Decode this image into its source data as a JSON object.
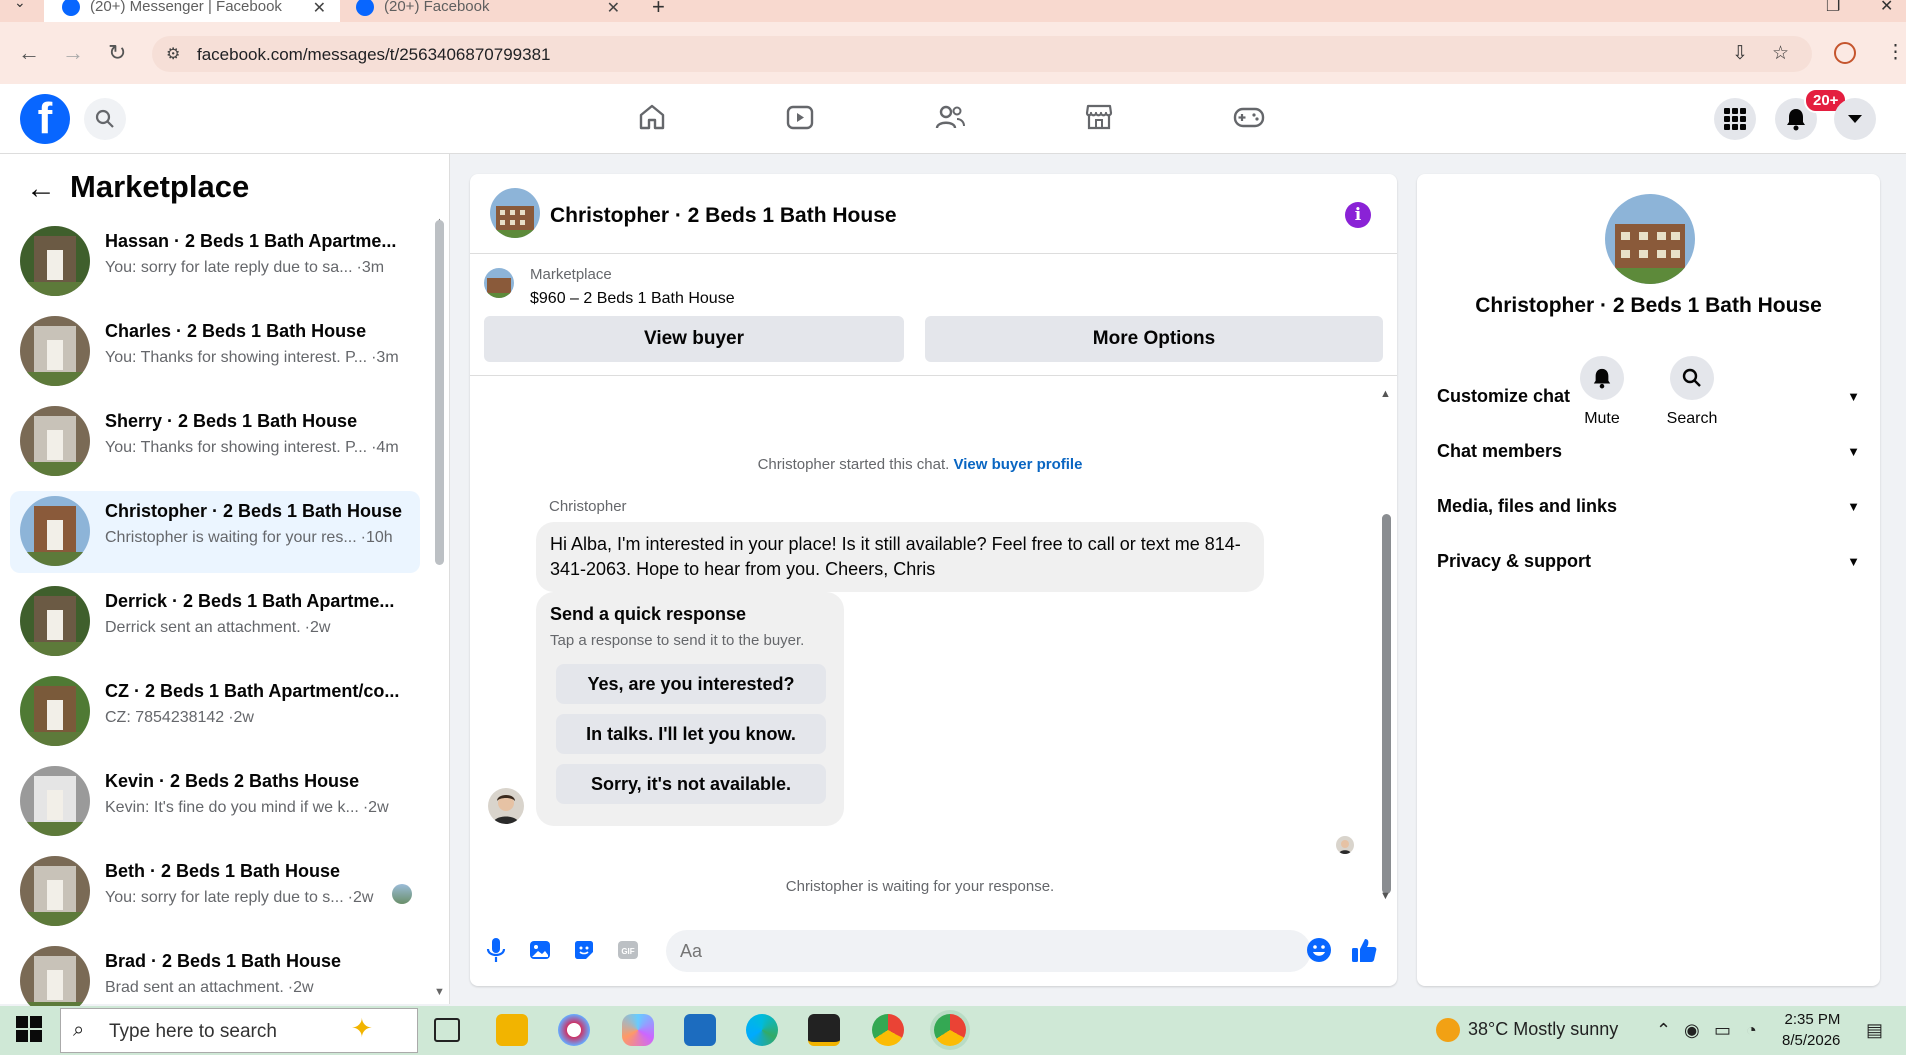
{
  "browser": {
    "tabs": [
      {
        "title": "(20+) Messenger | Facebook",
        "active": true
      },
      {
        "title": "(20+) Facebook",
        "active": false
      }
    ],
    "url": "facebook.com/messages/t/2563406870799381"
  },
  "fbnav": {
    "notification_count": "20+"
  },
  "sidebar": {
    "title": "Marketplace",
    "conversations": [
      {
        "name": "Hassan · 2 Beds 1 Bath Apartme...",
        "preview": "You: sorry for late reply due to sa...",
        "time": "·3m"
      },
      {
        "name": "Charles · 2 Beds 1 Bath House",
        "preview": "You: Thanks for showing interest. P...",
        "time": "·3m"
      },
      {
        "name": "Sherry · 2 Beds 1 Bath House",
        "preview": "You: Thanks for showing interest. P...",
        "time": "·4m"
      },
      {
        "name": "Christopher · 2 Beds 1 Bath House",
        "preview": "Christopher is waiting for your res...",
        "time": "·10h",
        "active": true
      },
      {
        "name": "Derrick · 2 Beds 1 Bath Apartme...",
        "preview": "Derrick sent an attachment.",
        "time": "·2w"
      },
      {
        "name": "CZ · 2 Beds 1 Bath Apartment/co...",
        "preview": "CZ: 7854238142",
        "time": "·2w"
      },
      {
        "name": "Kevin · 2 Beds 2 Baths House",
        "preview": "Kevin: It's fine do you mind if we k...",
        "time": "·2w"
      },
      {
        "name": "Beth · 2 Beds 1 Bath House",
        "preview": "You: sorry for late reply due to s...",
        "time": "·2w"
      },
      {
        "name": "Brad · 2 Beds 1 Bath House",
        "preview": "Brad sent an attachment.",
        "time": "·2w"
      }
    ]
  },
  "chat": {
    "title": "Christopher · 2 Beds 1 Bath House",
    "listing_label": "Marketplace",
    "listing_price": "$960 – 2 Beds 1 Bath House",
    "view_buyer": "View buyer",
    "more_options": "More Options",
    "started_text": "Christopher started this chat.",
    "view_profile": "View buyer profile",
    "sender": "Christopher",
    "message": "Hi Alba, I'm interested in your place! Is it still available? Feel free to call or text me 814-341-2063. Hope to hear from you. Cheers, Chris",
    "quick_title": "Send a quick response",
    "quick_sub": "Tap a response to send it to the buyer.",
    "quick_options": [
      "Yes, are you interested?",
      "In talks. I'll let you know.",
      "Sorry, it's not available."
    ],
    "waiting": "Christopher is waiting for your response.",
    "input_placeholder": "Aa"
  },
  "right_panel": {
    "name": "Christopher · 2 Beds 1 Bath House",
    "mute": "Mute",
    "search": "Search",
    "sections": [
      "Customize chat",
      "Chat members",
      "Media, files and links",
      "Privacy & support"
    ]
  },
  "taskbar": {
    "search_placeholder": "Type here to search",
    "weather": "38°C  Mostly sunny",
    "time": "2:35 PM",
    "date": "8/5/2026"
  },
  "colors": {
    "fb_blue": "#0866ff",
    "active_conv": "#ebf5ff",
    "info_purple": "#8a22d6",
    "link_blue": "#0a66c2",
    "badge_red": "#e41e3f"
  }
}
